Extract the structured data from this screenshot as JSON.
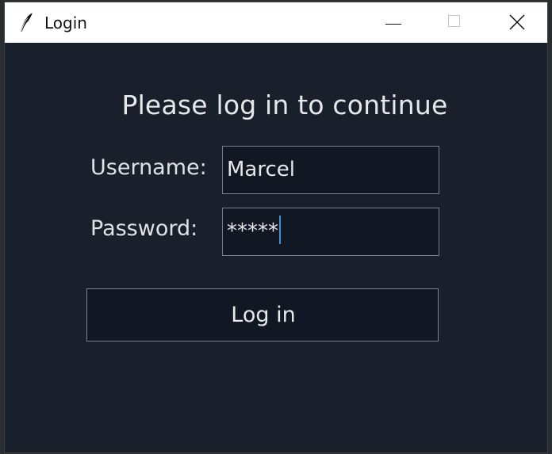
{
  "window": {
    "title": "Login",
    "icon": "feather-icon",
    "controls": {
      "minimize_icon": "minimize-icon",
      "maximize_icon": "maximize-icon",
      "close_icon": "close-icon"
    }
  },
  "form": {
    "heading": "Please log in to continue",
    "username": {
      "label": "Username:",
      "value": "Marcel"
    },
    "password": {
      "label": "Password:",
      "value": "*****"
    },
    "submit_label": "Log in"
  },
  "colors": {
    "background": "#1a202b",
    "field_background": "#121823",
    "border": "#7b8189",
    "text": "#e6e8ea",
    "caret": "#3f8fd6"
  }
}
